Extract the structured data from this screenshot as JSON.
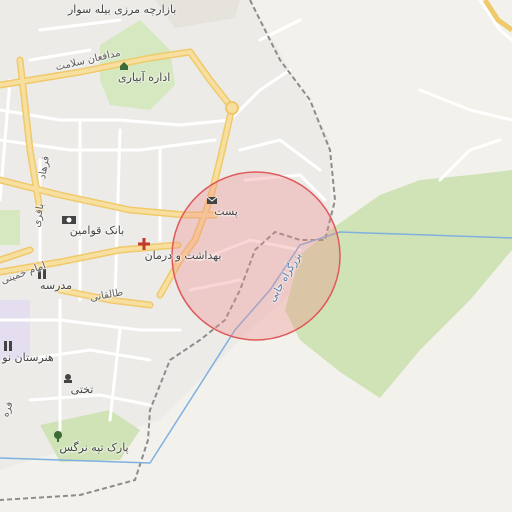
{
  "map": {
    "colors": {
      "background": "#f3f1ec",
      "green_area": "#cfe3b6",
      "major_road": "#f2d27a",
      "minor_road": "#ffffff",
      "boundary": "#7fb0e0",
      "railway": "#888888",
      "radius_fill": "#f28b8b",
      "radius_stroke": "#e05a5a"
    },
    "search_radius": "shown"
  },
  "labels": {
    "bazaar": "بازارچه مرزی بیله سوار",
    "street_salamat": "مدافعان سلامت",
    "irrigation": "اداره آبیاری",
    "post": "پست",
    "bank": "بانک قوامین",
    "health": "بهداشت و درمان",
    "school": "مدرسه",
    "conservatory": "هنرستان نو",
    "takhti": "تختی",
    "park": "پارک تپه نرگس",
    "street_farhad": "فرهاد",
    "street_bagheri": "باقری",
    "street_imam": "امام خمینی",
    "street_taleghani": "طالقانی",
    "street_bozorgrah": "بزرگراه جابی",
    "edge_fa": "فره"
  },
  "icons": {
    "irrigation": "office-icon",
    "post": "envelope-icon",
    "bank": "bank-icon",
    "health": "medical-cross-icon",
    "school": "school-icon",
    "conservatory": "school-icon",
    "takhti": "stadium-icon",
    "park": "tree-icon"
  }
}
